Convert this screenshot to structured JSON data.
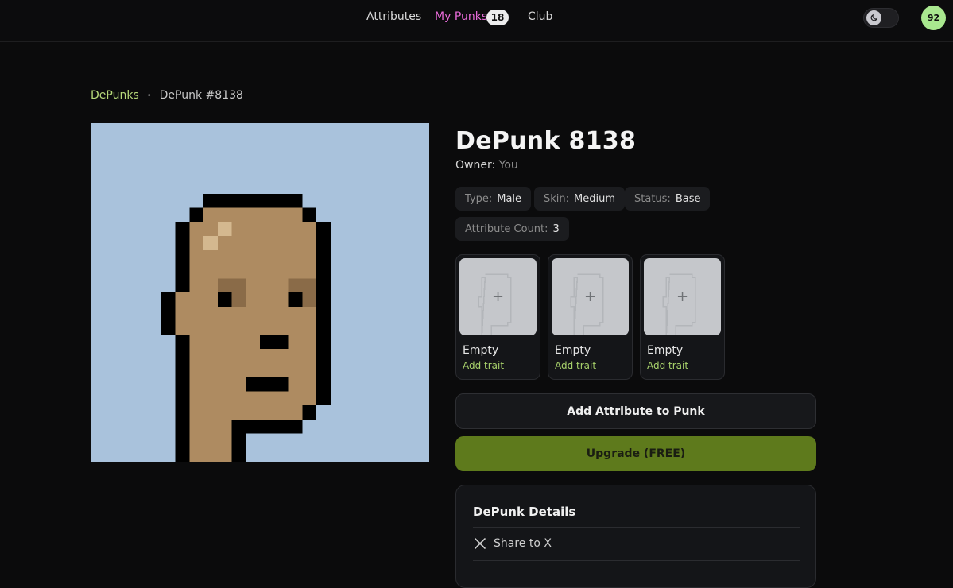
{
  "nav": {
    "attributes": "Attributes",
    "my_punks": "My Punks",
    "my_punks_count": "18",
    "club": "Club"
  },
  "theme_toggle": {
    "icon": "moon-icon"
  },
  "user": {
    "avatar_text": "92"
  },
  "breadcrumb": {
    "root": "DePunks",
    "current": "DePunk #8138"
  },
  "punk": {
    "title": "DePunk 8138",
    "owner_label": "Owner:",
    "owner_value": "You",
    "background_color": "#a9c2dc",
    "skin_color": "#ae8b61"
  },
  "chips": [
    {
      "key": "Type:",
      "value": "Male"
    },
    {
      "key": "Skin:",
      "value": "Medium"
    },
    {
      "key": "Status:",
      "value": "Base"
    },
    {
      "key": "Attribute Count:",
      "value": "3"
    }
  ],
  "slots": [
    {
      "title": "Empty",
      "action": "Add trait",
      "icon": "plus-icon"
    },
    {
      "title": "Empty",
      "action": "Add trait",
      "icon": "plus-icon"
    },
    {
      "title": "Empty",
      "action": "Add trait",
      "icon": "plus-icon"
    }
  ],
  "buttons": {
    "add_attribute": "Add Attribute to Punk",
    "upgrade": "Upgrade (FREE)"
  },
  "details": {
    "title": "DePunk Details",
    "share_label": "Share to X",
    "share_icon": "x-logo-icon"
  },
  "colors": {
    "accent_green": "#a9d36c",
    "accent_pink": "#e86bd8",
    "upgrade_bg": "#5e7a1c"
  }
}
